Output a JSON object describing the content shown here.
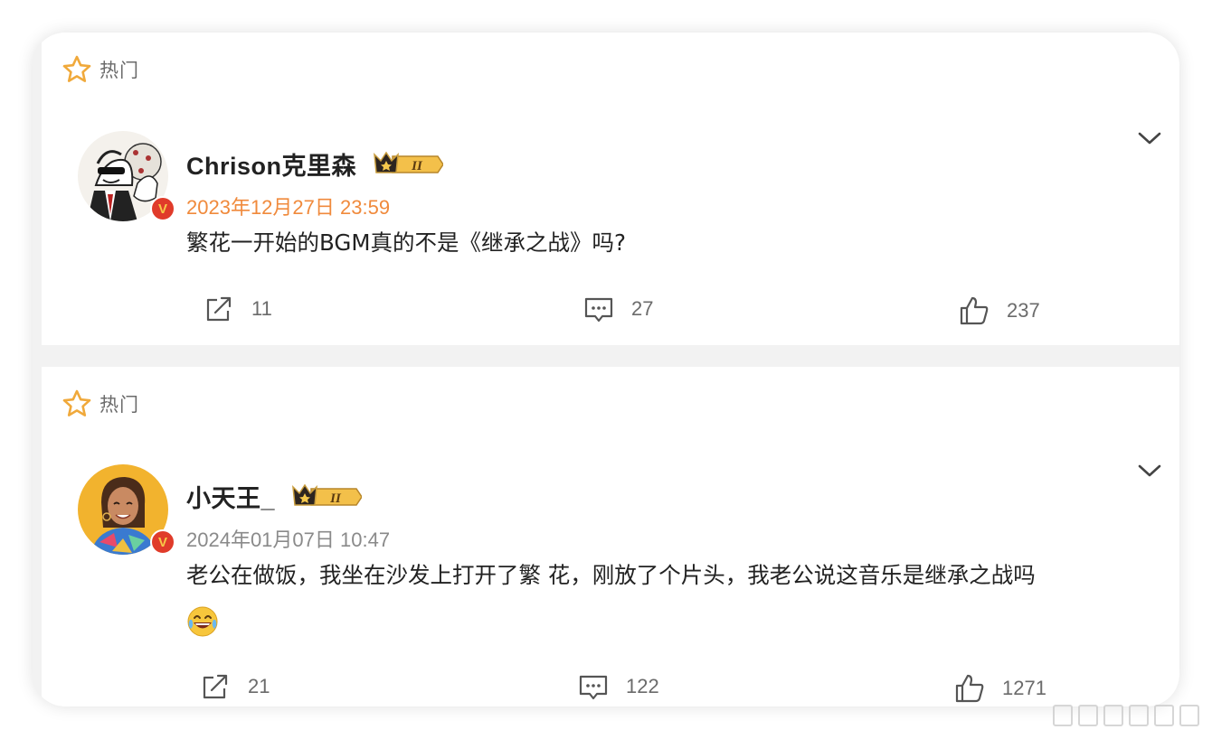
{
  "comments": [
    {
      "hot_label": "热门",
      "username": "Chrison克里森",
      "timestamp": "2023年12月27日 23:59",
      "timestamp_color": "#f08a3c",
      "text": "繁花一开始的BGM真的不是《继承之战》吗?",
      "level_badge": "II",
      "verified_mark": "V",
      "actions": {
        "repost": "11",
        "comment": "27",
        "like": "237"
      }
    },
    {
      "hot_label": "热门",
      "username": "小天王_",
      "timestamp": "2024年01月07日 10:47",
      "timestamp_color": "#8a8a8a",
      "text": "老公在做饭，我坐在沙发上打开了繁 花，刚放了个片头，我老公说这音乐是继承之战吗",
      "emoji": "laughing-tears-emoji",
      "level_badge": "II",
      "verified_mark": "V",
      "actions": {
        "repost": "21",
        "comment": "122",
        "like": "1271"
      }
    }
  ],
  "colors": {
    "accent": "#f0a93b",
    "verified": "#e03b2a",
    "muted": "#6b6b6b"
  }
}
